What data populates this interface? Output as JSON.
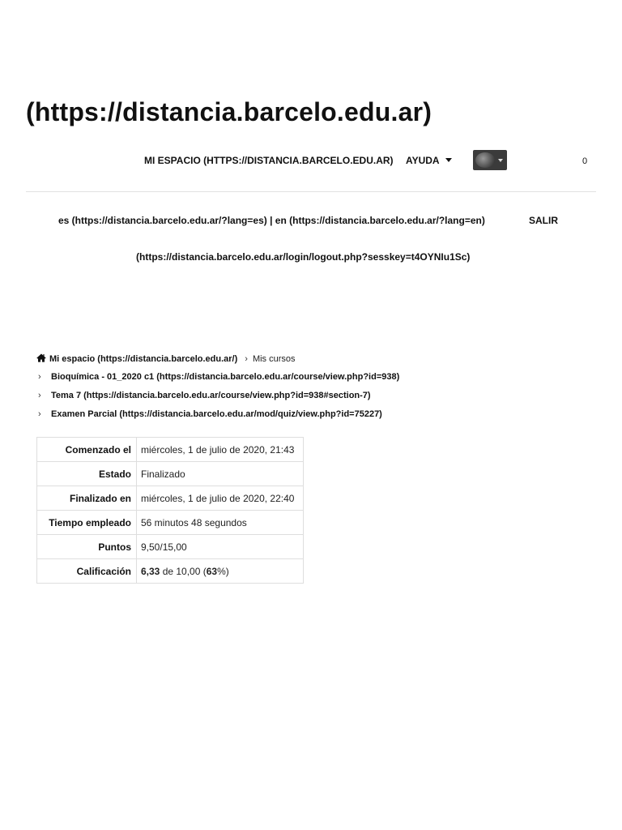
{
  "site": {
    "title": "(https://distancia.barcelo.edu.ar)"
  },
  "nav": {
    "my_space": "MI ESPACIO (HTTPS://DISTANCIA.BARCELO.EDU.AR)",
    "help": "AYUDA",
    "count": "0"
  },
  "lang": {
    "es": "es (https://distancia.barcelo.edu.ar/?lang=es)",
    "separator": "|",
    "en": "en (https://distancia.barcelo.edu.ar/?lang=en)",
    "logout": "SALIR",
    "logout_url": "(https://distancia.barcelo.edu.ar/login/logout.php?sesskey=t4OYNIu1Sc)"
  },
  "breadcrumb": {
    "home": "Mi espacio (https://distancia.barcelo.edu.ar/)",
    "my_courses": "Mis cursos",
    "course": "Bioquímica - 01_2020 c1 (https://distancia.barcelo.edu.ar/course/view.php?id=938)",
    "section": "Tema 7 (https://distancia.barcelo.edu.ar/course/view.php?id=938#section-7)",
    "quiz": "Examen Parcial (https://distancia.barcelo.edu.ar/mod/quiz/view.php?id=75227)",
    "separator": "›"
  },
  "summary": {
    "rows": [
      {
        "label": "Comenzado el",
        "value": "miércoles, 1 de julio de 2020, 21:43"
      },
      {
        "label": "Estado",
        "value": "Finalizado"
      },
      {
        "label": "Finalizado en",
        "value": "miércoles, 1 de julio de 2020, 22:40"
      },
      {
        "label": "Tiempo empleado",
        "value": "56 minutos 48 segundos"
      },
      {
        "label": "Puntos",
        "value": "9,50/15,00"
      }
    ],
    "grade": {
      "label": "Calificación",
      "score": "6,33",
      "mid": " de 10,00 (",
      "percent": "63",
      "end": "%)"
    }
  },
  "icons": {
    "home": "home-icon",
    "help_caret": "caret-down-icon",
    "avatar_caret": "caret-down-icon"
  }
}
